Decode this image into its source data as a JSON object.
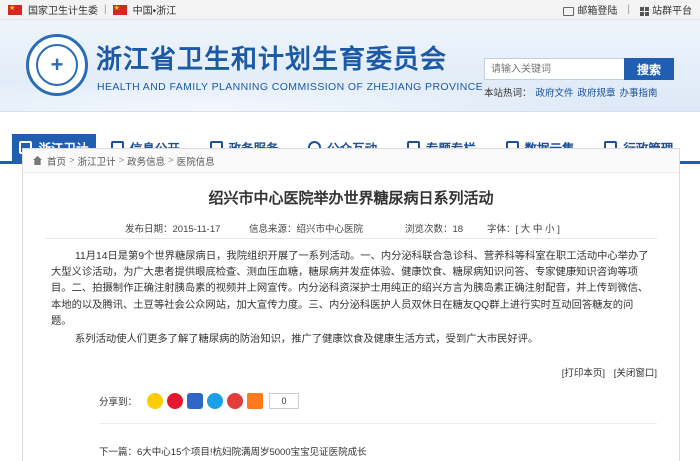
{
  "topbar": {
    "left_links": [
      "国家卫生计生委",
      "中国•浙江"
    ],
    "right_links": [
      "邮箱登陆",
      "站群平台"
    ]
  },
  "header": {
    "title": "浙江省卫生和计划生育委员会",
    "subtitle": "HEALTH AND FAMILY PLANNING COMMISSION OF ZHEJIANG PROVINCE",
    "search_placeholder": "请输入关键词",
    "search_button": "搜索",
    "hot_label": "本站热词：",
    "hot_terms": [
      "政府文件",
      "政府规章",
      "办事指南"
    ]
  },
  "nav": {
    "items": [
      {
        "label": "浙江卫计",
        "icon": "home-icon",
        "active": true
      },
      {
        "label": "信息公开",
        "icon": "document-icon",
        "active": false
      },
      {
        "label": "政务服务",
        "icon": "service-icon",
        "active": false
      },
      {
        "label": "公众互动",
        "icon": "chat-icon",
        "active": false
      },
      {
        "label": "专题专栏",
        "icon": "bookmark-icon",
        "active": false
      },
      {
        "label": "数据云集",
        "icon": "chart-icon",
        "active": false
      },
      {
        "label": "行政管理",
        "icon": "folder-icon",
        "active": false
      }
    ]
  },
  "breadcrumb": [
    "首页",
    "浙江卫计",
    "政务信息",
    "医院信息"
  ],
  "article": {
    "title": "绍兴市中心医院举办世界糖尿病日系列活动",
    "publish_label": "发布日期：2015-11-17",
    "source_label": "信息来源：绍兴市中心医院",
    "views_label": "浏览次数：18",
    "font_label": "字体：[ 大 中 小 ]",
    "paragraphs": [
      "11月14日是第9个世界糖尿病日，我院组织开展了一系列活动。一、内分泌科联合急诊科、营养科等科室在职工活动中心举办了大型义诊活动，为广大患者提供眼底检查、测血压血糖，糖尿病并发症体验、健康饮食、糖尿病知识问答、专家健康知识咨询等项目。二、拍摄制作正确注射胰岛素的视频并上网宣传。内分泌科资深护士用纯正的绍兴方言为胰岛素正确注射配音，并上传到微信、本地的以及腾讯、土豆等社会公众网站，加大宣传力度。三、内分泌科医护人员双休日在糖友QQ群上进行实时互动回答糖友的问题。",
      "系列活动使人们更多了解了糖尿病的防治知识，推广了健康饮食及健康生活方式，受到广大市民好评。"
    ],
    "print_label": "[打印本页]",
    "close_label": "[关闭窗口]",
    "share_label": "分享到：",
    "share_count": "0",
    "next_label": "下一篇：6大中心15个项目!杭妇院满周岁5000宝宝见证医院成长"
  },
  "colors": {
    "brand_blue": "#1f5eb0",
    "title_blue": "#1c5aa6"
  }
}
